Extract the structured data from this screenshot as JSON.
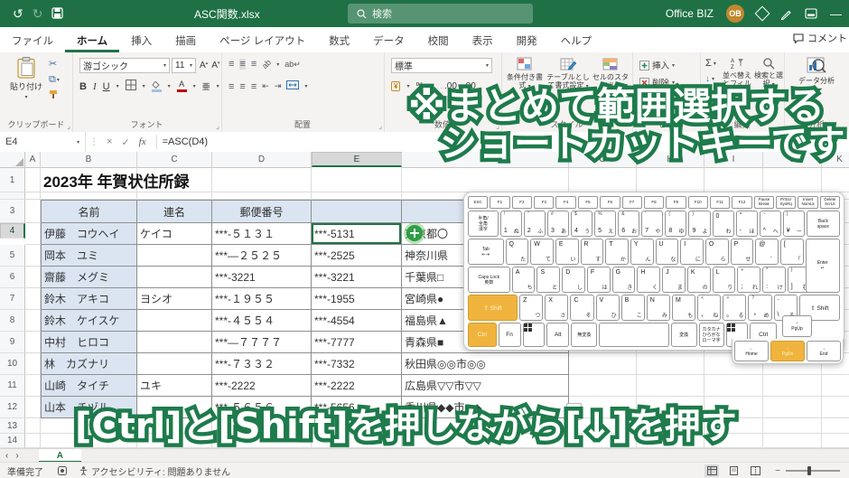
{
  "titlebar": {
    "title": "ASC関数.xlsx",
    "search": "検索",
    "account": "Office BIZ",
    "avatar": "OB"
  },
  "tabs": {
    "items": [
      "ファイル",
      "ホーム",
      "挿入",
      "描画",
      "ページ レイアウト",
      "数式",
      "データ",
      "校閲",
      "表示",
      "開発",
      "ヘルプ"
    ],
    "active": "ホーム",
    "comments": "コメント"
  },
  "ribbon": {
    "clipboard": {
      "paste": "貼り付け",
      "label": "クリップボード"
    },
    "font": {
      "name": "游ゴシック",
      "size": "11",
      "bold": "B",
      "italic": "I",
      "underline": "U",
      "furigana": "亜",
      "label": "フォント"
    },
    "align": {
      "label": "配置"
    },
    "number": {
      "format": "標準",
      "percent": "%",
      "label": "数値"
    },
    "styles": {
      "conditional": "条件付き書式",
      "table": "テーブルとして書式設定",
      "cell": "セルのスタイル",
      "label": "スタイル"
    },
    "cells": {
      "insert": "挿入",
      "del": "削除",
      "format": "書式",
      "label": "セル"
    },
    "editing": {
      "sigma": "Σ",
      "sort": "並べ替えとフィルター",
      "find": "検索と選択",
      "label": "編集"
    },
    "analysis": {
      "button": "データ分析",
      "label": "分析"
    }
  },
  "formula_bar": {
    "cell_ref": "E4",
    "fx": "fx",
    "formula": "=ASC(D4)"
  },
  "sheet": {
    "title": "2023年 年賀状住所録",
    "columns": [
      "A",
      "B",
      "C",
      "D",
      "E",
      "F",
      "G",
      "H",
      "I",
      "J",
      "K"
    ],
    "selected_column": "E",
    "selected_row": 4,
    "headers": {
      "name": "名前",
      "joint": "連名",
      "postal": "郵便番号"
    },
    "rows": [
      {
        "n": 4,
        "name": "伊藤　コウヘイ",
        "joint": "ケイコ",
        "postal_full": "***-５１３１",
        "postal_half": "***-5131",
        "address": "東京都〇"
      },
      {
        "n": 5,
        "name": "岡本　ユミ",
        "joint": "",
        "postal_full": "***―２５２５",
        "postal_half": "***-2525",
        "address": "神奈川県"
      },
      {
        "n": 6,
        "name": "齋藤　メグミ",
        "joint": "",
        "postal_full": "***-3221",
        "postal_half": "***-3221",
        "address": "千葉県□"
      },
      {
        "n": 7,
        "name": "鈴木　アキコ",
        "joint": "ヨシオ",
        "postal_full": "***-１９５５",
        "postal_half": "***-1955",
        "address": "宮崎県●"
      },
      {
        "n": 8,
        "name": "鈴木　ケイスケ",
        "joint": "",
        "postal_full": "***-４５５４",
        "postal_half": "***-4554",
        "address": "福島県▲"
      },
      {
        "n": 9,
        "name": "中村　ヒロコ",
        "joint": "",
        "postal_full": "***―７７７７",
        "postal_half": "***-7777",
        "address": "青森県■"
      },
      {
        "n": 10,
        "name": "林　カズナリ",
        "joint": "",
        "postal_full": "***-７３３２",
        "postal_half": "***-7332",
        "address": "秋田県◎◎市◎◎"
      },
      {
        "n": 11,
        "name": "山崎　タイチ",
        "joint": "ユキ",
        "postal_full": "***-2222",
        "postal_half": "***-2222",
        "address": "広島県▽▽市▽▽"
      },
      {
        "n": 12,
        "name": "山本　チヅル",
        "joint": "",
        "postal_full": "***-５６５６",
        "postal_half": "***-5656",
        "address": "香川県◆◆市◆◆"
      }
    ],
    "sheet_tab": "A"
  },
  "keyboard": {
    "fn_row": [
      "ESC",
      "F1",
      "F2",
      "F3",
      "F4",
      "F5",
      "F6",
      "F7",
      "F8",
      "F9",
      "F10",
      "F11",
      "F12",
      "Pause\nBreak",
      "PrtScr\nSysRq",
      "Insert\nNumLk",
      "Delete\nScrLk"
    ],
    "rows": [
      [
        {
          "m": "半角/\n全角\n漢字",
          "cls": "tiny",
          "w": 1.35
        },
        {
          "s": "!",
          "m": "1",
          "k": "ぬ"
        },
        {
          "s": "\"",
          "m": "2",
          "k": "ふ"
        },
        {
          "s": "#",
          "m": "3",
          "k": "あ"
        },
        {
          "s": "$",
          "m": "4",
          "k": "う"
        },
        {
          "s": "%",
          "m": "5",
          "k": "え"
        },
        {
          "s": "&",
          "m": "6",
          "k": "お"
        },
        {
          "s": "'",
          "m": "7",
          "k": "や"
        },
        {
          "s": "(",
          "m": "8",
          "k": "ゆ"
        },
        {
          "s": ")",
          "m": "9",
          "k": "よ"
        },
        {
          "m": "0",
          "k": "わ"
        },
        {
          "s": "=",
          "m": "-",
          "k": "ほ"
        },
        {
          "s": "~",
          "m": "^",
          "k": "へ"
        },
        {
          "s": "|",
          "m": "¥",
          "k": "ー"
        },
        {
          "m": "Back\nspace",
          "cls": "tiny",
          "w": 1.5
        }
      ],
      [
        {
          "m": "Tab\n⇤⇥",
          "cls": "tiny",
          "w": 1.5
        },
        {
          "m": "Q",
          "k": "た"
        },
        {
          "m": "W",
          "k": "て"
        },
        {
          "m": "E",
          "k": "い"
        },
        {
          "m": "R",
          "k": "す"
        },
        {
          "m": "T",
          "k": "か"
        },
        {
          "m": "Y",
          "k": "ん"
        },
        {
          "m": "U",
          "k": "な"
        },
        {
          "m": "I",
          "k": "に"
        },
        {
          "m": "O",
          "k": "ら"
        },
        {
          "m": "P",
          "k": "せ"
        },
        {
          "m": "@",
          "k": "゛"
        },
        {
          "m": "[",
          "k": "「"
        },
        {
          "m": "Enter\n↵",
          "cls": "tiny",
          "w": 1.45,
          "tall": true
        }
      ],
      [
        {
          "m": "Caps Lock\n英数",
          "cls": "tiny",
          "w": 1.8
        },
        {
          "m": "A",
          "k": "ち"
        },
        {
          "m": "S",
          "k": "と"
        },
        {
          "m": "D",
          "k": "し"
        },
        {
          "m": "F",
          "k": "は"
        },
        {
          "m": "G",
          "k": "き"
        },
        {
          "m": "H",
          "k": "く"
        },
        {
          "m": "J",
          "k": "ま"
        },
        {
          "m": "K",
          "k": "の"
        },
        {
          "m": "L",
          "k": "り"
        },
        {
          "s": "+",
          "m": ";",
          "k": "れ"
        },
        {
          "s": "*",
          "m": ":",
          "k": "け"
        },
        {
          "s": "}",
          "m": "]",
          "k": "む"
        },
        {
          "w": 1.2,
          "ghost": true
        }
      ],
      [
        {
          "m": "⇧ Shift",
          "cls": "word",
          "w": 2.2,
          "hl": true
        },
        {
          "m": "Z",
          "k": "つ"
        },
        {
          "m": "X",
          "k": "さ"
        },
        {
          "m": "C",
          "k": "そ"
        },
        {
          "m": "V",
          "k": "ひ"
        },
        {
          "m": "B",
          "k": "こ"
        },
        {
          "m": "N",
          "k": "み"
        },
        {
          "m": "M",
          "k": "も"
        },
        {
          "s": "<",
          "m": "、",
          "k": "ね"
        },
        {
          "s": ">",
          "m": "。",
          "k": "る"
        },
        {
          "s": "?",
          "m": "・",
          "k": "め"
        },
        {
          "s": "_",
          "m": "\\",
          "k": "ろ"
        },
        {
          "m": "⇧ Shift",
          "cls": "word",
          "w": 1.8
        }
      ],
      [
        {
          "m": "Ctrl",
          "cls": "word",
          "w": 1.3,
          "hl": true
        },
        {
          "m": "Fn",
          "cls": "word"
        },
        {
          "m": "",
          "cls": "win",
          "name": "windows-key"
        },
        {
          "m": "Alt",
          "cls": "word"
        },
        {
          "m": "無変換",
          "cls": "tiny",
          "w": 1.1
        },
        {
          "m": "",
          "cls": "word space",
          "w": 3.3,
          "name": "space-key"
        },
        {
          "m": "変換",
          "cls": "tiny",
          "w": 1.1
        },
        {
          "m": "カタカナ\nひらがな\nローマ字",
          "cls": "tiny",
          "w": 1.05
        },
        {
          "m": "",
          "cls": "win",
          "name": "menu-key"
        },
        {
          "m": "Ctrl",
          "cls": "word",
          "w": 1.2
        },
        {
          "w": 2.9,
          "ghost": true
        }
      ]
    ],
    "up_key": {
      "m": "↑\nPgUp"
    },
    "ext_keys": [
      {
        "m": "←\nHome"
      },
      {
        "m": "↓\nPgDn",
        "hl": true
      },
      {
        "m": "→\nEnd"
      }
    ]
  },
  "annotations": {
    "top_line1": "※まとめて範囲選択する",
    "top_line2": "ショートカットキーです",
    "bottom": "[Ctrl]と[Shift]を押しながら[↓]を押す"
  },
  "statusbar": {
    "ready": "準備完了",
    "accessibility": "アクセシビリティ: 問題ありません"
  }
}
